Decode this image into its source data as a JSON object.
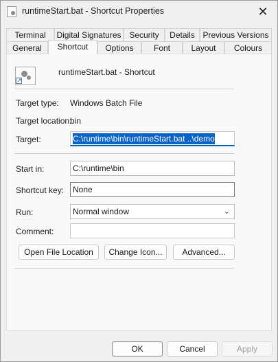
{
  "window": {
    "title": "runtimeStart.bat - Shortcut Properties",
    "close_glyph": "✕"
  },
  "tabs_back": [
    "Terminal",
    "Digital Signatures",
    "Security",
    "Details",
    "Previous Versions"
  ],
  "tabs_front": [
    "General",
    "Shortcut",
    "Options",
    "Font",
    "Layout",
    "Colours"
  ],
  "active_tab": "Shortcut",
  "shortcut": {
    "name": "runtimeStart.bat - Shortcut",
    "target_type_label": "Target type:",
    "target_type_value": "Windows Batch File",
    "target_location_label": "Target location:",
    "target_location_value": "bin",
    "target_label": "Target:",
    "target_value": "C:\\runtime\\bin\\runtimeStart.bat ..\\demo",
    "start_in_label": "Start in:",
    "start_in_value": "C:\\runtime\\bin",
    "shortcut_key_label": "Shortcut key:",
    "shortcut_key_value": "None",
    "run_label": "Run:",
    "run_value": "Normal window",
    "comment_label": "Comment:",
    "comment_value": "",
    "open_location_label": "Open File Location",
    "change_icon_label": "Change Icon...",
    "advanced_label": "Advanced..."
  },
  "footer": {
    "ok_label": "OK",
    "cancel_label": "Cancel",
    "apply_label": "Apply"
  },
  "colors": {
    "selection": "#0a64c8",
    "focus_underline": "#0066b4"
  }
}
